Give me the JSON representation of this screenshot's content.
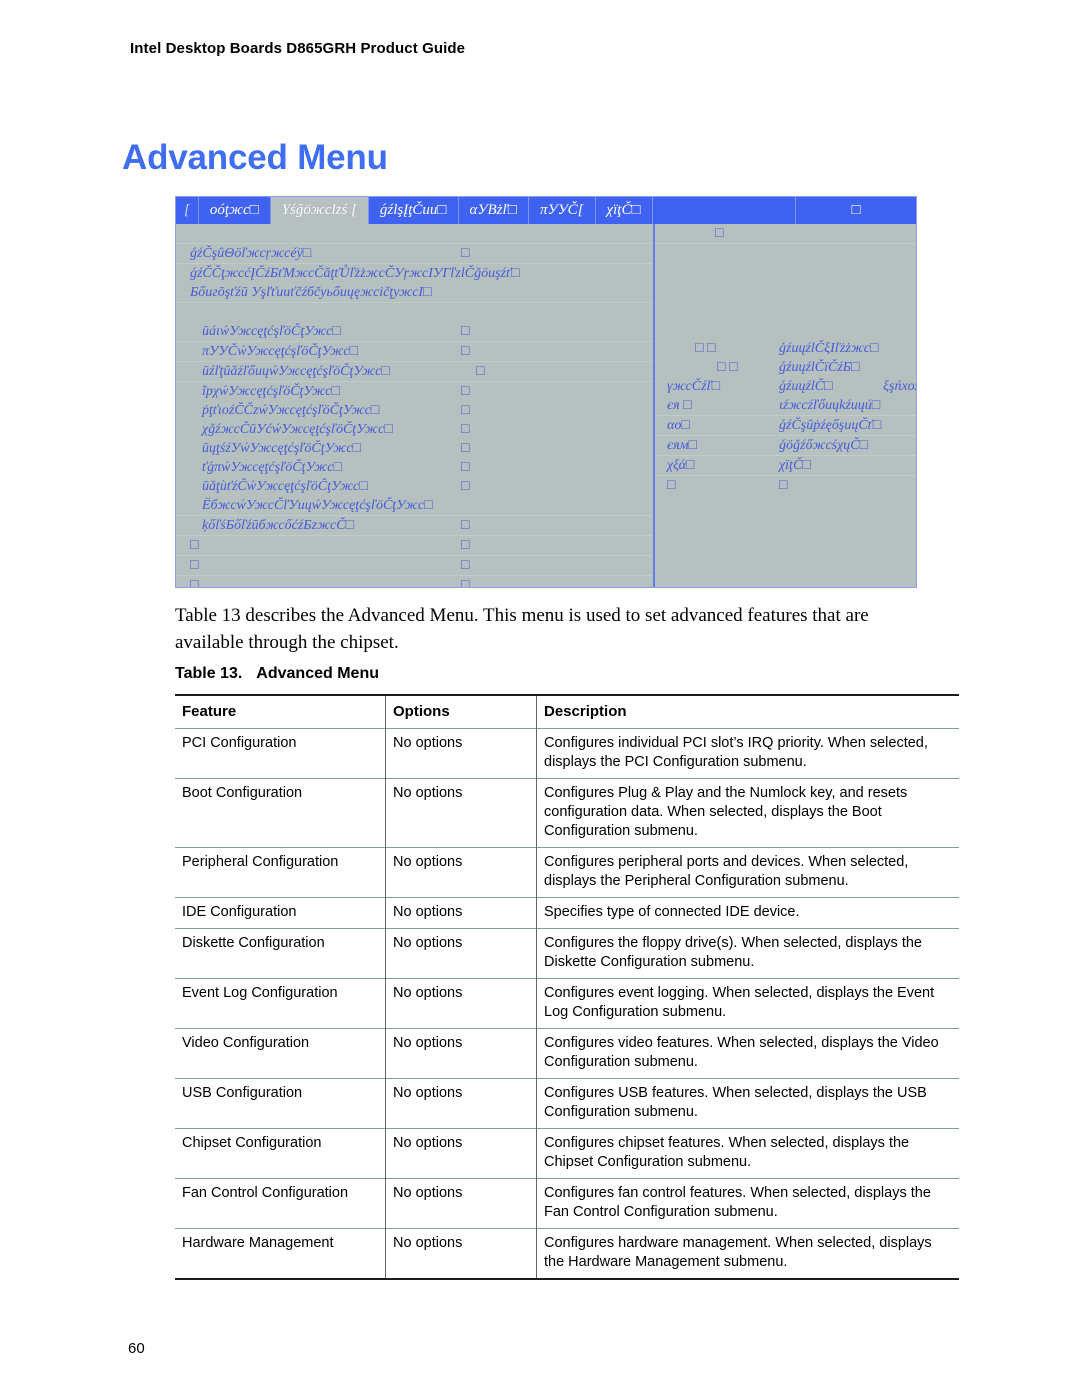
{
  "document": {
    "running_header": "Intel Desktop Boards D865GRH Product Guide",
    "page_number": "60",
    "title": "Advanced Menu",
    "paragraph": "Table 13 describes the Advanced Menu.  This menu is used to set advanced features that are available through the chipset."
  },
  "bios_screenshot": {
    "menubar": {
      "lead": "[",
      "items": [
        {
          "label": "oóţжc□",
          "active": false
        },
        {
          "label": "Yśğöжclzś   [",
          "active": true
        },
        {
          "label": "ǵźlşĮţČuu□",
          "active": false
        },
        {
          "label": "αУBżľ□",
          "active": false
        },
        {
          "label": "πУУČ[",
          "active": false
        },
        {
          "label": "χïţČ□",
          "active": false
        }
      ],
      "end_glyph": "□"
    },
    "left_rows": [
      {
        "label": "",
        "value": "",
        "indent": false,
        "sep": true
      },
      {
        "label": "ǵźČşûΘöľжcŗжcéÿ□",
        "value": "□",
        "indent": false,
        "sep": true
      },
      {
        "label": "ǵźČČţжcćĮČźБťМжcČăţťŮľżżжcČУŗжcIУГľzlČǧöuşźť□",
        "value": "",
        "indent": false,
        "sep": false
      },
      {
        "label": "Бőuгōşťźū УşľťuuťčźбčуьőuųęжcičţужcI□",
        "value": "",
        "indent": false,
        "sep": true
      },
      {
        "label": "",
        "value": "",
        "indent": false,
        "sep": false
      },
      {
        "label": "ūáιẃУжcęţćşľöČţУжc□",
        "value": "□",
        "indent": true,
        "sep": true
      },
      {
        "label": "πУУČẃУжcęţćşľöČţУжc□",
        "value": "□",
        "indent": true,
        "sep": true
      },
      {
        "label": "ūźľţûăźľőuųẃУжcęţćşľöČţУжc□",
        "value": "□",
        "indent": true,
        "sep": true
      },
      {
        "label": "ĩpχẃУжcęţćşľöČţУжc□",
        "value": "□",
        "indent": true,
        "sep": false
      },
      {
        "label": "ṗţťιoźČČzẃУжcęţćşľöČţУжc□",
        "value": "□",
        "indent": true,
        "sep": false
      },
      {
        "label": "χǧźжcČūУćẃУжcęţćşľöČţУжc□",
        "value": "□",
        "indent": true,
        "sep": false
      },
      {
        "label": "ūųţśźУẃУжcęţćşľöČţУжc□",
        "value": "□",
        "indent": true,
        "sep": false
      },
      {
        "label": "ťǵπẃУжcęţćşľöČţУжc□",
        "value": "□",
        "indent": true,
        "sep": false
      },
      {
        "label": "ūăţùťźČẃУжcęţćşľöČţУжc□",
        "value": "□",
        "indent": true,
        "sep": false
      },
      {
        "label": "ЁбжcẃУжcČľУuųẃУжcęţćşľöČţУжc□",
        "value": "",
        "indent": true,
        "sep": true
      },
      {
        "label": "ķőľśБőľźūбжcőćźБzжcČ□",
        "value": "□",
        "indent": true,
        "sep": true
      },
      {
        "label": "□",
        "value": "□",
        "indent": false,
        "sep": true
      },
      {
        "label": "□",
        "value": "□",
        "indent": false,
        "sep": true
      },
      {
        "label": "□",
        "value": "□",
        "indent": false,
        "sep": false
      }
    ],
    "right_rows": [
      {
        "keys": "",
        "topbox": "□",
        "desc": "",
        "desc2": "",
        "sep": true,
        "kcls": ""
      },
      {
        "keys": "",
        "topbox": "",
        "desc": "",
        "desc2": "",
        "sep": false,
        "kcls": ""
      },
      {
        "keys": "",
        "topbox": "",
        "desc": "",
        "desc2": "",
        "sep": false,
        "kcls": ""
      },
      {
        "keys": "",
        "topbox": "",
        "desc": "",
        "desc2": "",
        "sep": false,
        "kcls": ""
      },
      {
        "keys": "",
        "topbox": "",
        "desc": "",
        "desc2": "",
        "sep": false,
        "kcls": ""
      },
      {
        "keys": "",
        "topbox": "",
        "desc": "",
        "desc2": "",
        "sep": false,
        "kcls": ""
      },
      {
        "keys": "□    □",
        "topbox": "",
        "desc": "ǵźuųźlČξIľżżжc□",
        "desc2": "",
        "sep": false,
        "kcls": "r2"
      },
      {
        "keys": "□    □",
        "topbox": "",
        "desc": "ǵźuųźlČïČźБ□",
        "desc2": "",
        "sep": false,
        "kcls": "r3"
      },
      {
        "keys": "γжcČźľ□",
        "topbox": "",
        "desc": "ǵźuųźlČ□",
        "desc2": "ξşńxoźжcş□",
        "sep": false,
        "kcls": ""
      },
      {
        "keys": "єя  □",
        "topbox": "",
        "desc": "ιźжcźľőuųkźuųú□",
        "desc2": "",
        "sep": true,
        "kcls": ""
      },
      {
        "keys": "αo□",
        "topbox": "",
        "desc": "ǵźČşûṗźęőşuųČť□",
        "desc2": "",
        "sep": true,
        "kcls": ""
      },
      {
        "keys": "єям□",
        "topbox": "",
        "desc": "ǵöǧźőжcśχųČ□",
        "desc2": "",
        "sep": true,
        "kcls": ""
      },
      {
        "keys": "χξά□",
        "topbox": "",
        "desc": "χïţČ□",
        "desc2": "",
        "sep": true,
        "kcls": ""
      },
      {
        "keys": "□",
        "topbox": "",
        "desc": "□",
        "desc2": "",
        "sep": false,
        "kcls": ""
      }
    ]
  },
  "table": {
    "caption_number": "Table 13.",
    "caption_title": "Advanced Menu",
    "headers": [
      "Feature",
      "Options",
      "Description"
    ],
    "rows": [
      {
        "feature": "PCI Configuration",
        "options": "No options",
        "description": "Configures individual PCI slot’s IRQ priority.  When selected, displays the PCI Configuration submenu."
      },
      {
        "feature": "Boot Configuration",
        "options": "No options",
        "description": "Configures Plug & Play and the Numlock key, and resets configuration data.  When selected, displays the Boot Configuration submenu."
      },
      {
        "feature": "Peripheral Configuration",
        "options": "No options",
        "description": "Configures peripheral ports and devices.  When selected, displays the Peripheral Configuration submenu."
      },
      {
        "feature": "IDE Configuration",
        "options": "No options",
        "description": "Specifies type of connected IDE device."
      },
      {
        "feature": "Diskette Configuration",
        "options": "No options",
        "description": "Configures the floppy drive(s).  When selected, displays the Diskette Configuration submenu."
      },
      {
        "feature": "Event Log Configuration",
        "options": "No options",
        "description": "Configures event logging.  When selected, displays the Event Log Configuration submenu."
      },
      {
        "feature": "Video Configuration",
        "options": "No options",
        "description": "Configures video features.  When selected, displays the Video Configuration submenu."
      },
      {
        "feature": "USB Configuration",
        "options": "No options",
        "description": "Configures USB features.  When selected, displays the USB Configuration submenu."
      },
      {
        "feature": "Chipset Configuration",
        "options": "No options",
        "description": "Configures chipset features.  When selected, displays the Chipset Configuration submenu."
      },
      {
        "feature": "Fan Control Configuration",
        "options": "No options",
        "description": "Configures fan control features.  When selected, displays the Fan Control Configuration submenu."
      },
      {
        "feature": "Hardware Management",
        "options": "No options",
        "description": "Configures hardware management.  When selected, displays the Hardware Management submenu."
      }
    ]
  },
  "colors": {
    "heading_blue": "#3f6ef2",
    "bios_menubar_blue": "#3f62f0",
    "bios_body_gray": "#b6c1bf",
    "bios_text_blue": "#4659d9",
    "table_rule_green": "#7f9e94"
  }
}
